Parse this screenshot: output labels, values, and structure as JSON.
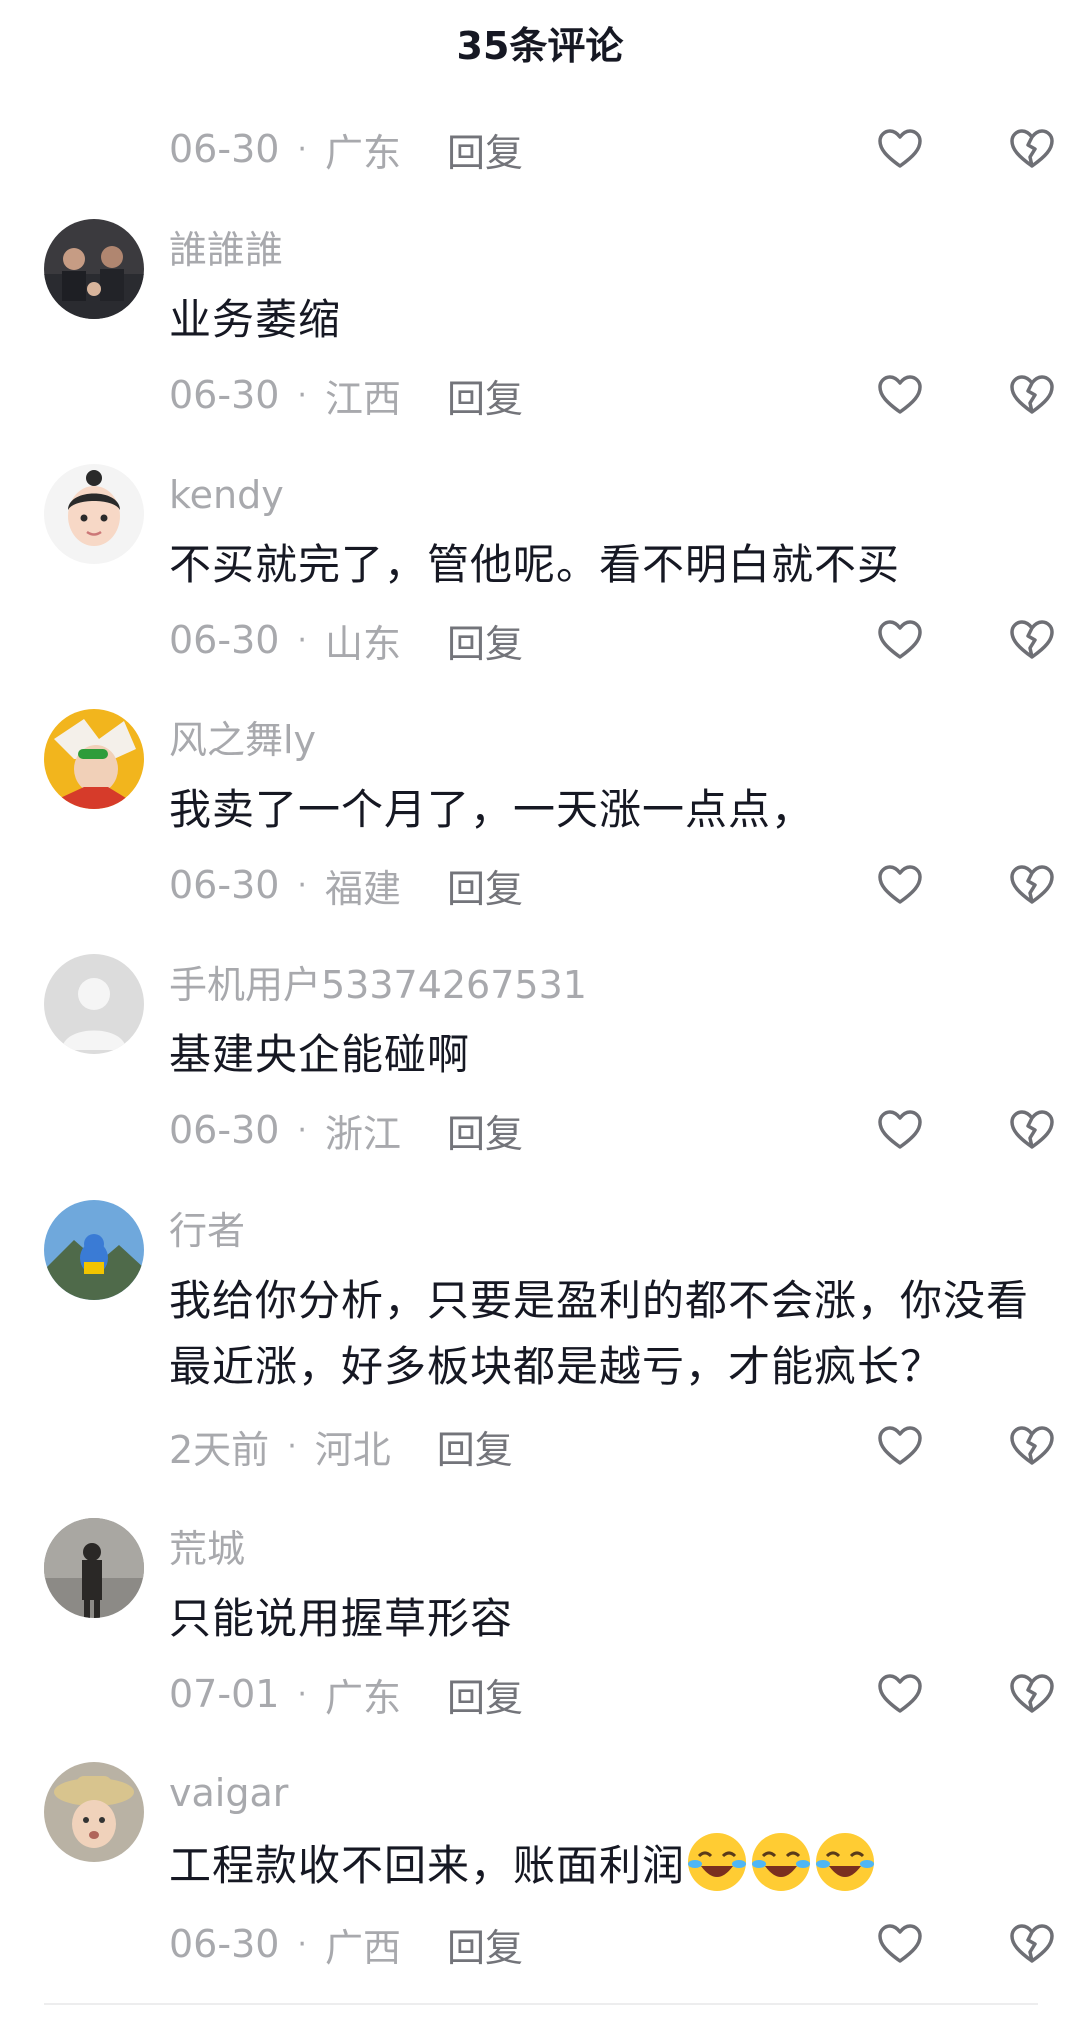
{
  "header": {
    "title": "35条评论"
  },
  "top_meta": {
    "date": "06-30",
    "location": "广东",
    "reply": "回复"
  },
  "comments": [
    {
      "user": "誰誰誰",
      "text": "业务萎缩",
      "date": "06-30",
      "location": "江西",
      "reply": "回复",
      "avatar": "group-photo-avatar"
    },
    {
      "user": "kendy",
      "text": "不买就完了，管他呢。看不明白就不买",
      "date": "06-30",
      "location": "山东",
      "reply": "回复",
      "avatar": "cartoon-boy-avatar"
    },
    {
      "user": "风之舞ly",
      "text": "我卖了一个月了，一天涨一点点，",
      "date": "06-30",
      "location": "福建",
      "reply": "回复",
      "avatar": "anime-character-avatar"
    },
    {
      "user": "手机用户53374267531",
      "text": "基建央企能碰啊",
      "date": "06-30",
      "location": "浙江",
      "reply": "回复",
      "avatar": "default-user-avatar"
    },
    {
      "user": "行者",
      "text": "我给你分析，只要是盈利的都不会涨，你没看最近涨，好多板块都是越亏，才能疯长？",
      "date": "2天前",
      "location": "河北",
      "reply": "回复",
      "avatar": "mountain-toy-avatar"
    },
    {
      "user": "荒城",
      "text": "只能说用握草形容",
      "date": "07-01",
      "location": "广东",
      "reply": "回复",
      "avatar": "silhouette-avatar"
    },
    {
      "user": "vaigar",
      "text": "工程款收不回来，账面利润",
      "emoji": [
        "laughing-crying-emoji",
        "laughing-crying-emoji",
        "laughing-crying-emoji"
      ],
      "date": "06-30",
      "location": "广西",
      "reply": "回复",
      "avatar": "straw-hat-child-avatar"
    }
  ],
  "colors": {
    "text": "#161823",
    "meta": "#a8a9ad",
    "reply": "#73747a",
    "icon": "#6e6f75"
  },
  "icons": {
    "like": "heart-outline-icon",
    "dislike": "broken-heart-icon"
  }
}
